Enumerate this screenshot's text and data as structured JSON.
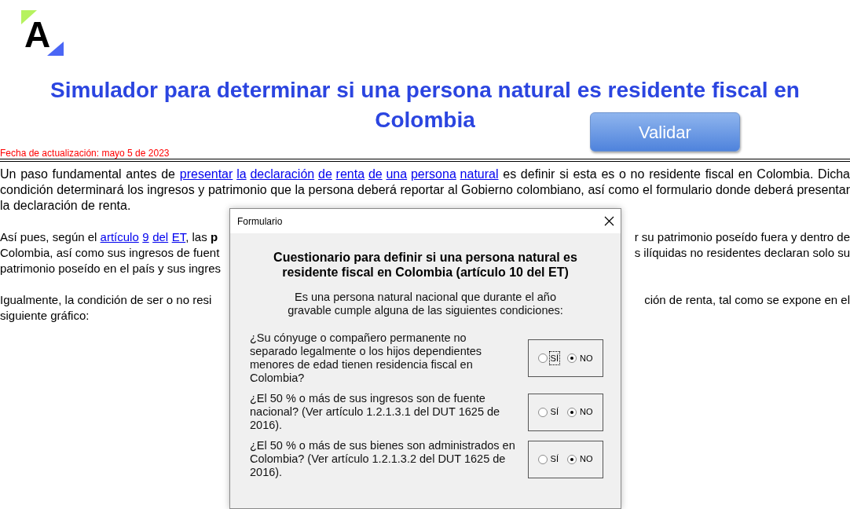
{
  "logo": {
    "text": "A"
  },
  "title": [
    "Simulador para determinar si una persona natural es residente fiscal en",
    "Colombia"
  ],
  "validate_button": "Validar",
  "updated": "Fecha de actualización: mayo 5 de 2023",
  "intro": [
    {
      "kind": "text",
      "text": "Un paso fundamental antes de "
    },
    {
      "kind": "links",
      "items": [
        "presentar",
        "la",
        "declaración",
        "de",
        "renta",
        "de",
        "una",
        "persona",
        "natural"
      ]
    },
    {
      "kind": "text",
      "text": " es definir si esta es o no residente fiscal en Colombia. Dicha condición determinará los ingresos y patrimonio que la persona deberá reportar al Gobierno colombiano, así como el formulario donde deberá presentar la declaración de renta."
    }
  ],
  "partial_paragraphs": [
    {
      "lines": [
        {
          "left": [
            {
              "kind": "text",
              "text": "Así pues, según el "
            },
            {
              "kind": "links",
              "items": [
                "artículo",
                "9",
                "del",
                "ET"
              ]
            },
            {
              "kind": "text",
              "text": ", las "
            },
            {
              "kind": "bold",
              "text": "p"
            }
          ],
          "right": "r su patrimonio poseído fuera y dentro de"
        },
        {
          "left": [
            {
              "kind": "text",
              "text": "Colombia, así como sus ingresos de fuent"
            }
          ],
          "right": "s ilíquidas no residentes declaran solo su"
        },
        {
          "left": [
            {
              "kind": "text",
              "text": "patrimonio poseído en el país y sus ingres"
            }
          ]
        }
      ]
    },
    {
      "lines": [
        {
          "left": [
            {
              "kind": "text",
              "text": "Igualmente, la condición de ser o no resi"
            }
          ],
          "right": "ción de renta, tal como se expone en el"
        },
        {
          "left": [
            {
              "kind": "text",
              "text": "siguiente gráfico:"
            }
          ]
        }
      ]
    }
  ],
  "dialog": {
    "title": "Formulario",
    "heading": "Cuestionario para definir si una persona natural es residente fiscal en Colombia (artículo 10 del ET)",
    "intro": "Es una persona natural nacional que durante el año gravable cumple alguna de las siguientes condiciones:",
    "questions": [
      {
        "text": "¿Su cónyuge o compañero permanente no separado legalmente o los hijos dependientes menores de edad tienen residencia fiscal en Colombia?",
        "options": [
          {
            "label": "SÍ",
            "selected": false,
            "focused": true
          },
          {
            "label": "NO",
            "selected": true,
            "focused": false
          }
        ]
      },
      {
        "text": "¿El 50 % o más de sus ingresos son de fuente nacional? (Ver artículo 1.2.1.3.1 del DUT 1625 de 2016).",
        "options": [
          {
            "label": "SÍ",
            "selected": false,
            "focused": false
          },
          {
            "label": "NO",
            "selected": true,
            "focused": false
          }
        ]
      },
      {
        "text": "¿El 50 % o más de sus bienes son administrados en Colombia? (Ver artículo 1.2.1.3.2 del DUT 1625 de 2016).",
        "options": [
          {
            "label": "SÍ",
            "selected": false,
            "focused": false
          },
          {
            "label": "NO",
            "selected": true,
            "focused": false
          }
        ]
      }
    ]
  }
}
